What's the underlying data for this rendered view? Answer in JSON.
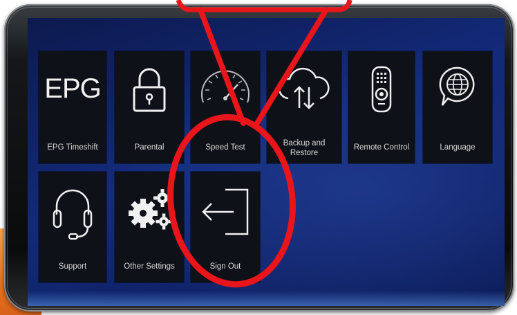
{
  "tiles": [
    {
      "id": "epg",
      "label": "EPG Timeshift",
      "icon_text": "EPG",
      "icon": "epg-icon"
    },
    {
      "id": "parental",
      "label": "Parental",
      "icon": "padlock-icon"
    },
    {
      "id": "speed",
      "label": "Speed Test",
      "icon": "speedometer-icon"
    },
    {
      "id": "backup",
      "label": "Backup and Restore",
      "icon": "cloud-sync-icon"
    },
    {
      "id": "remote",
      "label": "Remote Control",
      "icon": "remote-control-icon"
    },
    {
      "id": "language",
      "label": "Language",
      "icon": "globe-speech-icon"
    },
    {
      "id": "support",
      "label": "Support",
      "icon": "headset-icon"
    },
    {
      "id": "othersettings",
      "label": "Other Settings",
      "icon": "gears-icon"
    },
    {
      "id": "signout",
      "label": "Sign Out",
      "icon": "sign-out-icon"
    }
  ],
  "colors": {
    "annotation": "#e8151b",
    "tile_bg": "#0e1117",
    "screen_bg": "#132a7a",
    "accent_orange": "#e8741c"
  }
}
